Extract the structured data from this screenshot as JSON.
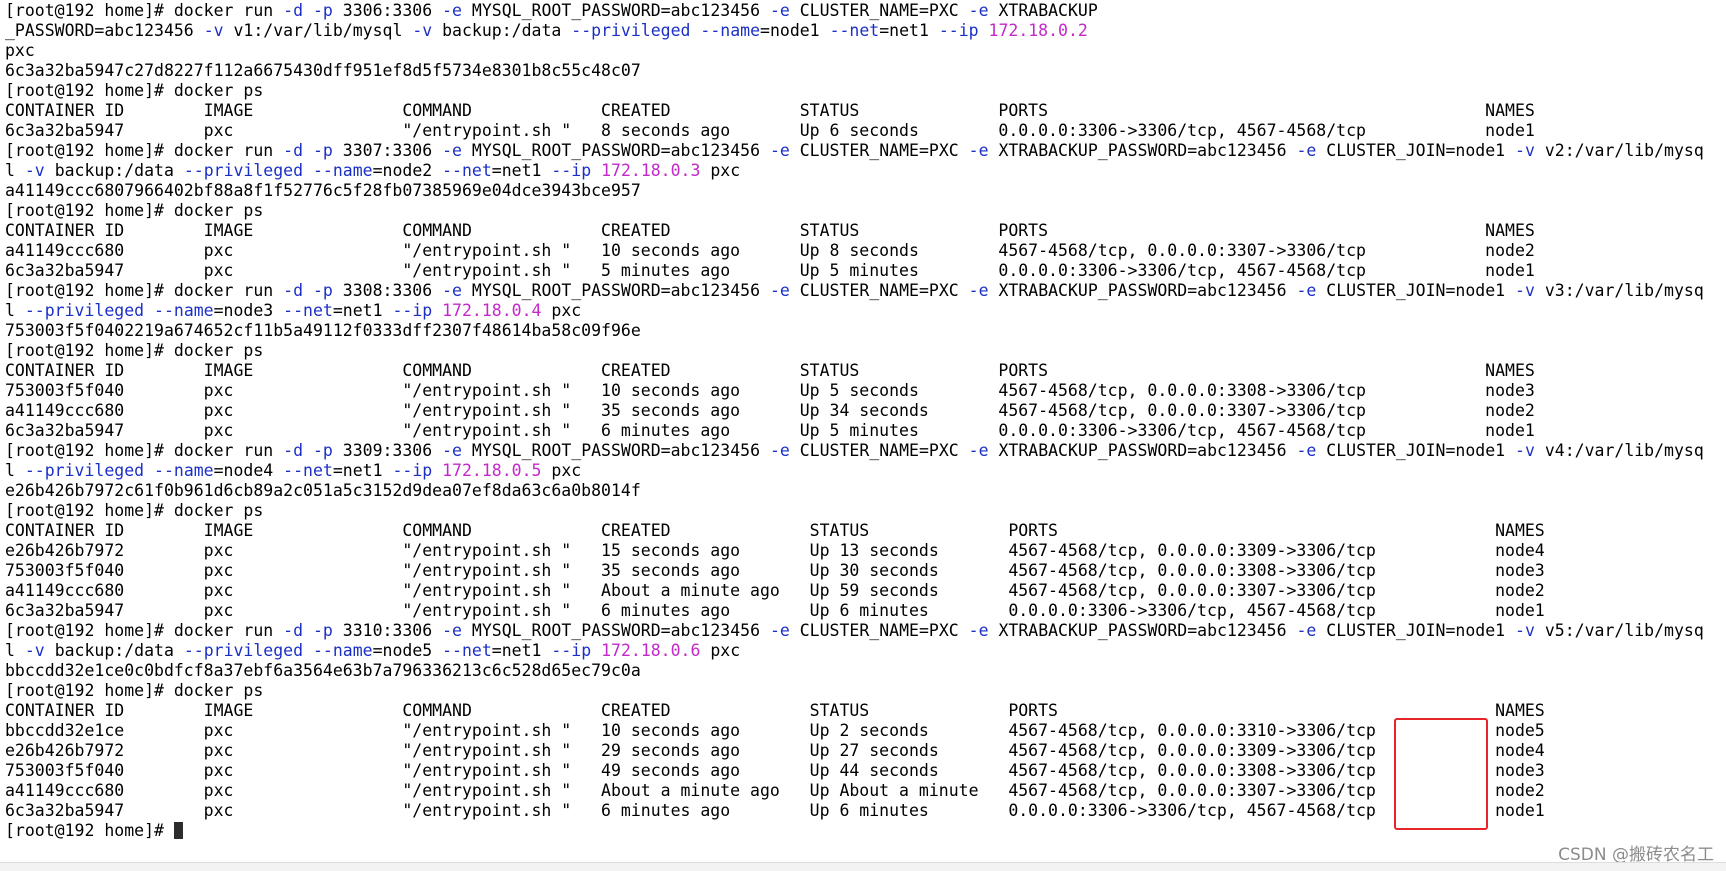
{
  "terminal": {
    "lines": [
      [
        [
          "[root@192 home]# docker run ",
          ""
        ],
        [
          "-d -p ",
          "f"
        ],
        [
          "3306:3306 ",
          ""
        ],
        [
          "-e ",
          "f"
        ],
        [
          "MYSQL_ROOT_PASSWORD=abc123456 ",
          ""
        ],
        [
          "-e ",
          "f"
        ],
        [
          "CLUSTER_NAME=PXC ",
          ""
        ],
        [
          "-e ",
          "f"
        ],
        [
          "XTRABACKUP",
          ""
        ]
      ],
      [
        [
          "_PASSWORD=abc123456 ",
          ""
        ],
        [
          "-v ",
          "f"
        ],
        [
          "v1:/var/lib/mysql ",
          ""
        ],
        [
          "-v ",
          "f"
        ],
        [
          "backup:/data ",
          ""
        ],
        [
          "--privileged --name",
          "f"
        ],
        [
          "=node1 ",
          ""
        ],
        [
          "--net",
          "f"
        ],
        [
          "=net1 ",
          ""
        ],
        [
          "--ip ",
          "f"
        ],
        [
          "172.18.0.2",
          "i"
        ]
      ],
      [
        [
          "pxc",
          ""
        ]
      ],
      [
        [
          "6c3a32ba5947c27d8227f112a6675430dff951ef8d5f5734e8301b8c55c48c07",
          ""
        ]
      ],
      [
        [
          "[root@192 home]# docker ps",
          ""
        ]
      ],
      [
        [
          "CONTAINER ID        IMAGE               COMMAND             CREATED             STATUS              PORTS                                            NAMES",
          ""
        ]
      ],
      [
        [
          "6c3a32ba5947        pxc                 \"/entrypoint.sh \"   8 seconds ago       Up 6 seconds        0.0.0.0:3306->3306/tcp, 4567-4568/tcp            node1",
          ""
        ]
      ],
      [
        [
          "[root@192 home]# docker run ",
          ""
        ],
        [
          "-d -p ",
          "f"
        ],
        [
          "3307:3306 ",
          ""
        ],
        [
          "-e ",
          "f"
        ],
        [
          "MYSQL_ROOT_PASSWORD=abc123456 ",
          ""
        ],
        [
          "-e ",
          "f"
        ],
        [
          "CLUSTER_NAME=PXC ",
          ""
        ],
        [
          "-e ",
          "f"
        ],
        [
          "XTRABACKUP_PASSWORD=abc123456 ",
          ""
        ],
        [
          "-e ",
          "f"
        ],
        [
          "CLUSTER_JOIN=node1 ",
          ""
        ],
        [
          "-v ",
          "f"
        ],
        [
          "v2:/var/lib/mysq",
          ""
        ]
      ],
      [
        [
          "l ",
          ""
        ],
        [
          "-v ",
          "f"
        ],
        [
          "backup:/data ",
          ""
        ],
        [
          "--privileged --name",
          "f"
        ],
        [
          "=node2 ",
          ""
        ],
        [
          "--net",
          "f"
        ],
        [
          "=net1 ",
          ""
        ],
        [
          "--ip ",
          "f"
        ],
        [
          "172.18.0.3",
          "i"
        ],
        [
          " pxc",
          ""
        ]
      ],
      [
        [
          "a41149ccc6807966402bf88a8f1f52776c5f28fb07385969e04dce3943bce957",
          ""
        ]
      ],
      [
        [
          "[root@192 home]# docker ps",
          ""
        ]
      ],
      [
        [
          "CONTAINER ID        IMAGE               COMMAND             CREATED             STATUS              PORTS                                            NAMES",
          ""
        ]
      ],
      [
        [
          "a41149ccc680        pxc                 \"/entrypoint.sh \"   10 seconds ago      Up 8 seconds        4567-4568/tcp, 0.0.0.0:3307->3306/tcp            node2",
          ""
        ]
      ],
      [
        [
          "6c3a32ba5947        pxc                 \"/entrypoint.sh \"   5 minutes ago       Up 5 minutes        0.0.0.0:3306->3306/tcp, 4567-4568/tcp            node1",
          ""
        ]
      ],
      [
        [
          "[root@192 home]# docker run ",
          ""
        ],
        [
          "-d -p ",
          "f"
        ],
        [
          "3308:3306 ",
          ""
        ],
        [
          "-e ",
          "f"
        ],
        [
          "MYSQL_ROOT_PASSWORD=abc123456 ",
          ""
        ],
        [
          "-e ",
          "f"
        ],
        [
          "CLUSTER_NAME=PXC ",
          ""
        ],
        [
          "-e ",
          "f"
        ],
        [
          "XTRABACKUP_PASSWORD=abc123456 ",
          ""
        ],
        [
          "-e ",
          "f"
        ],
        [
          "CLUSTER_JOIN=node1 ",
          ""
        ],
        [
          "-v ",
          "f"
        ],
        [
          "v3:/var/lib/mysq",
          ""
        ]
      ],
      [
        [
          "l ",
          ""
        ],
        [
          "--privileged --name",
          "f"
        ],
        [
          "=node3 ",
          ""
        ],
        [
          "--net",
          "f"
        ],
        [
          "=net1 ",
          ""
        ],
        [
          "--ip ",
          "f"
        ],
        [
          "172.18.0.4",
          "i"
        ],
        [
          " pxc",
          ""
        ]
      ],
      [
        [
          "753003f5f0402219a674652cf11b5a49112f0333dff2307f48614ba58c09f96e",
          ""
        ]
      ],
      [
        [
          "[root@192 home]# docker ps",
          ""
        ]
      ],
      [
        [
          "CONTAINER ID        IMAGE               COMMAND             CREATED             STATUS              PORTS                                            NAMES",
          ""
        ]
      ],
      [
        [
          "753003f5f040        pxc                 \"/entrypoint.sh \"   10 seconds ago      Up 5 seconds        4567-4568/tcp, 0.0.0.0:3308->3306/tcp            node3",
          ""
        ]
      ],
      [
        [
          "a41149ccc680        pxc                 \"/entrypoint.sh \"   35 seconds ago      Up 34 seconds       4567-4568/tcp, 0.0.0.0:3307->3306/tcp            node2",
          ""
        ]
      ],
      [
        [
          "6c3a32ba5947        pxc                 \"/entrypoint.sh \"   6 minutes ago       Up 5 minutes        0.0.0.0:3306->3306/tcp, 4567-4568/tcp            node1",
          ""
        ]
      ],
      [
        [
          "[root@192 home]# docker run ",
          ""
        ],
        [
          "-d -p ",
          "f"
        ],
        [
          "3309:3306 ",
          ""
        ],
        [
          "-e ",
          "f"
        ],
        [
          "MYSQL_ROOT_PASSWORD=abc123456 ",
          ""
        ],
        [
          "-e ",
          "f"
        ],
        [
          "CLUSTER_NAME=PXC ",
          ""
        ],
        [
          "-e ",
          "f"
        ],
        [
          "XTRABACKUP_PASSWORD=abc123456 ",
          ""
        ],
        [
          "-e ",
          "f"
        ],
        [
          "CLUSTER_JOIN=node1 ",
          ""
        ],
        [
          "-v ",
          "f"
        ],
        [
          "v4:/var/lib/mysq",
          ""
        ]
      ],
      [
        [
          "l ",
          ""
        ],
        [
          "--privileged --name",
          "f"
        ],
        [
          "=node4 ",
          ""
        ],
        [
          "--net",
          "f"
        ],
        [
          "=net1 ",
          ""
        ],
        [
          "--ip ",
          "f"
        ],
        [
          "172.18.0.5",
          "i"
        ],
        [
          " pxc",
          ""
        ]
      ],
      [
        [
          "e26b426b7972c61f0b961d6cb89a2c051a5c3152d9dea07ef8da63c6a0b8014f",
          ""
        ]
      ],
      [
        [
          "[root@192 home]# docker ps",
          ""
        ]
      ],
      [
        [
          "CONTAINER ID        IMAGE               COMMAND             CREATED              STATUS              PORTS                                            NAMES",
          ""
        ]
      ],
      [
        [
          "e26b426b7972        pxc                 \"/entrypoint.sh \"   15 seconds ago       Up 13 seconds       4567-4568/tcp, 0.0.0.0:3309->3306/tcp            node4",
          ""
        ]
      ],
      [
        [
          "753003f5f040        pxc                 \"/entrypoint.sh \"   35 seconds ago       Up 30 seconds       4567-4568/tcp, 0.0.0.0:3308->3306/tcp            node3",
          ""
        ]
      ],
      [
        [
          "a41149ccc680        pxc                 \"/entrypoint.sh \"   About a minute ago   Up 59 seconds       4567-4568/tcp, 0.0.0.0:3307->3306/tcp            node2",
          ""
        ]
      ],
      [
        [
          "6c3a32ba5947        pxc                 \"/entrypoint.sh \"   6 minutes ago        Up 6 minutes        0.0.0.0:3306->3306/tcp, 4567-4568/tcp            node1",
          ""
        ]
      ],
      [
        [
          "[root@192 home]# docker run ",
          ""
        ],
        [
          "-d -p ",
          "f"
        ],
        [
          "3310:3306 ",
          ""
        ],
        [
          "-e ",
          "f"
        ],
        [
          "MYSQL_ROOT_PASSWORD=abc123456 ",
          ""
        ],
        [
          "-e ",
          "f"
        ],
        [
          "CLUSTER_NAME=PXC ",
          ""
        ],
        [
          "-e ",
          "f"
        ],
        [
          "XTRABACKUP_PASSWORD=abc123456 ",
          ""
        ],
        [
          "-e ",
          "f"
        ],
        [
          "CLUSTER_JOIN=node1 ",
          ""
        ],
        [
          "-v ",
          "f"
        ],
        [
          "v5:/var/lib/mysq",
          ""
        ]
      ],
      [
        [
          "l ",
          ""
        ],
        [
          "-v ",
          "f"
        ],
        [
          "backup:/data ",
          ""
        ],
        [
          "--privileged --name",
          "f"
        ],
        [
          "=node5 ",
          ""
        ],
        [
          "--net",
          "f"
        ],
        [
          "=net1 ",
          ""
        ],
        [
          "--ip ",
          "f"
        ],
        [
          "172.18.0.6",
          "i"
        ],
        [
          " pxc",
          ""
        ]
      ],
      [
        [
          "bbccdd32e1ce0c0bdfcf8a37ebf6a3564e63b7a796336213c6c528d65ec79c0a",
          ""
        ]
      ],
      [
        [
          "[root@192 home]# docker ps",
          ""
        ]
      ],
      [
        [
          "CONTAINER ID        IMAGE               COMMAND             CREATED              STATUS              PORTS                                            NAMES",
          ""
        ]
      ],
      [
        [
          "bbccdd32e1ce        pxc                 \"/entrypoint.sh \"   10 seconds ago       Up 2 seconds        4567-4568/tcp, 0.0.0.0:3310->3306/tcp            node5",
          ""
        ]
      ],
      [
        [
          "e26b426b7972        pxc                 \"/entrypoint.sh \"   29 seconds ago       Up 27 seconds       4567-4568/tcp, 0.0.0.0:3309->3306/tcp            node4",
          ""
        ]
      ],
      [
        [
          "753003f5f040        pxc                 \"/entrypoint.sh \"   49 seconds ago       Up 44 seconds       4567-4568/tcp, 0.0.0.0:3308->3306/tcp            node3",
          ""
        ]
      ],
      [
        [
          "a41149ccc680        pxc                 \"/entrypoint.sh \"   About a minute ago   Up About a minute   4567-4568/tcp, 0.0.0.0:3307->3306/tcp            node2",
          ""
        ]
      ],
      [
        [
          "6c3a32ba5947        pxc                 \"/entrypoint.sh \"   6 minutes ago        Up 6 minutes        0.0.0.0:3306->3306/tcp, 4567-4568/tcp            node1",
          ""
        ]
      ]
    ],
    "prompt": "[root@192 home]# "
  },
  "watermark": "CSDN @搬砖农名工",
  "colors": {
    "background": "#ffffff",
    "text": "#000000",
    "flag": "#1b2fc6",
    "ip": "#c328c9",
    "highlight": "#e5252a",
    "watermark": "#8c8c8c"
  }
}
